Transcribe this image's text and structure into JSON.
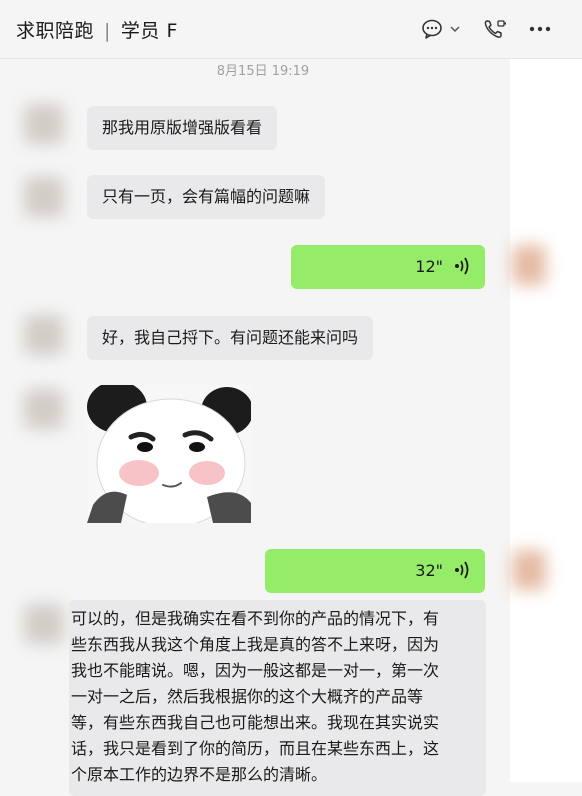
{
  "header": {
    "chat_name": "求职陪跑",
    "separator": "|",
    "member": "学员 F",
    "icons": [
      "chat-bubble-icon",
      "chevron-down-icon",
      "phone-video-icon",
      "more-icon"
    ]
  },
  "timestamp": "8月15日 19:19",
  "messages": [
    {
      "type": "text",
      "side": "left",
      "text": "那我用原版增强版看看"
    },
    {
      "type": "text",
      "side": "left",
      "text": "只有一页，会有篇幅的问题嘛"
    },
    {
      "type": "voice",
      "side": "right",
      "duration": "12\""
    },
    {
      "type": "text",
      "side": "left",
      "text": "好，我自己捋下。有问题还能来问吗"
    },
    {
      "type": "sticker",
      "side": "left",
      "icon": "panda-sticker-icon"
    },
    {
      "type": "voice",
      "side": "right",
      "duration": "32\""
    },
    {
      "type": "text",
      "side": "left",
      "lines": [
        "可以的，但是我确实在看不到你的产品的情况下，有",
        "些东西我从我这个角度上我是真的答不上来呀，因为",
        "我也不能瞎说。嗯，因为一般这都是一对一，第一次",
        "一对一之后，然后我根据你的这个大概齐的产品等",
        "等，有些东西我自己也可能想出来。我现在其实说实",
        "话，我只是看到了你的简历，而且在某些东西上，这",
        "个原本工作的边界不是那么的清晰。"
      ]
    }
  ],
  "colors": {
    "outgoing_bubble": "#95ec69",
    "incoming_bubble": "#e9e9eb",
    "background": "#f5f5f5"
  }
}
